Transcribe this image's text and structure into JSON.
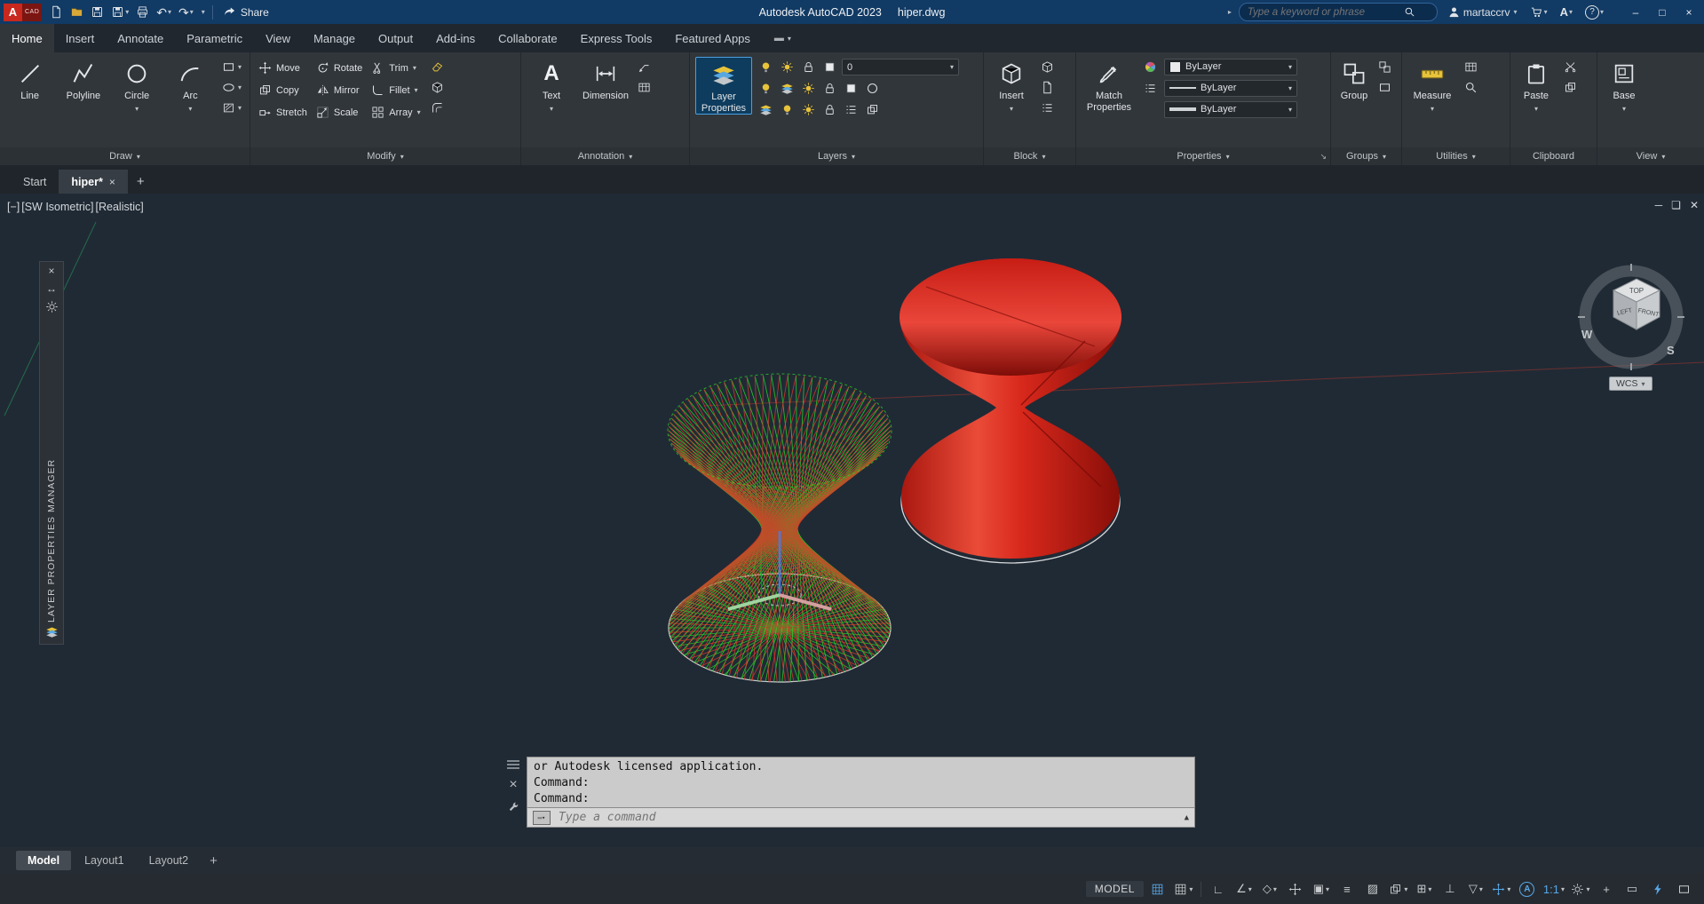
{
  "titlebar": {
    "logo": "A",
    "logo_sub": "CAD",
    "share_label": "Share",
    "app_title": "Autodesk AutoCAD 2023",
    "doc_title": "hiper.dwg",
    "search_placeholder": "Type a keyword or phrase",
    "username": "martaccrv"
  },
  "menu_tabs": [
    "Home",
    "Insert",
    "Annotate",
    "Parametric",
    "View",
    "Manage",
    "Output",
    "Add-ins",
    "Collaborate",
    "Express Tools",
    "Featured Apps"
  ],
  "ribbon": {
    "draw": {
      "label": "Draw",
      "line": "Line",
      "polyline": "Polyline",
      "circle": "Circle",
      "arc": "Arc"
    },
    "modify": {
      "label": "Modify",
      "move": "Move",
      "rotate": "Rotate",
      "trim": "Trim",
      "copy": "Copy",
      "mirror": "Mirror",
      "fillet": "Fillet",
      "stretch": "Stretch",
      "scale": "Scale",
      "array": "Array"
    },
    "annotation": {
      "label": "Annotation",
      "text": "Text",
      "dimension": "Dimension"
    },
    "layers": {
      "label": "Layers",
      "layer_properties": "Layer Properties",
      "current_layer": "0"
    },
    "block": {
      "label": "Block",
      "insert": "Insert"
    },
    "properties": {
      "label": "Properties",
      "match_properties": "Match Properties",
      "color": "ByLayer",
      "linetype": "ByLayer",
      "lineweight": "ByLayer"
    },
    "groups": {
      "label": "Groups",
      "group": "Group"
    },
    "utilities": {
      "label": "Utilities",
      "measure": "Measure"
    },
    "clipboard": {
      "label": "Clipboard",
      "paste": "Paste"
    },
    "view": {
      "label": "View",
      "base": "Base"
    }
  },
  "file_tabs": {
    "start": "Start",
    "active_doc": "hiper*"
  },
  "viewport": {
    "pan": "[−]",
    "view": "[SW Isometric]",
    "style": "[Realistic]",
    "wcs": "WCS",
    "viewcube": {
      "top": "TOP",
      "front": "FRONT",
      "left": "LEFT",
      "west": "W",
      "south": "S"
    }
  },
  "layer_palette_title": "LAYER PROPERTIES MANAGER",
  "command_window": {
    "history": [
      "or Autodesk licensed application.",
      "Command:",
      "Command:"
    ],
    "input_placeholder": "Type a command"
  },
  "layout_tabs": {
    "model": "Model",
    "layout1": "Layout1",
    "layout2": "Layout2"
  },
  "statusbar": {
    "model": "MODEL",
    "scale": "1:1"
  },
  "colors": {
    "mesh_green": "#25d425",
    "mesh_red": "#e2372a",
    "solid_red": "#d8281c",
    "accent_blue": "#57a8e8"
  }
}
